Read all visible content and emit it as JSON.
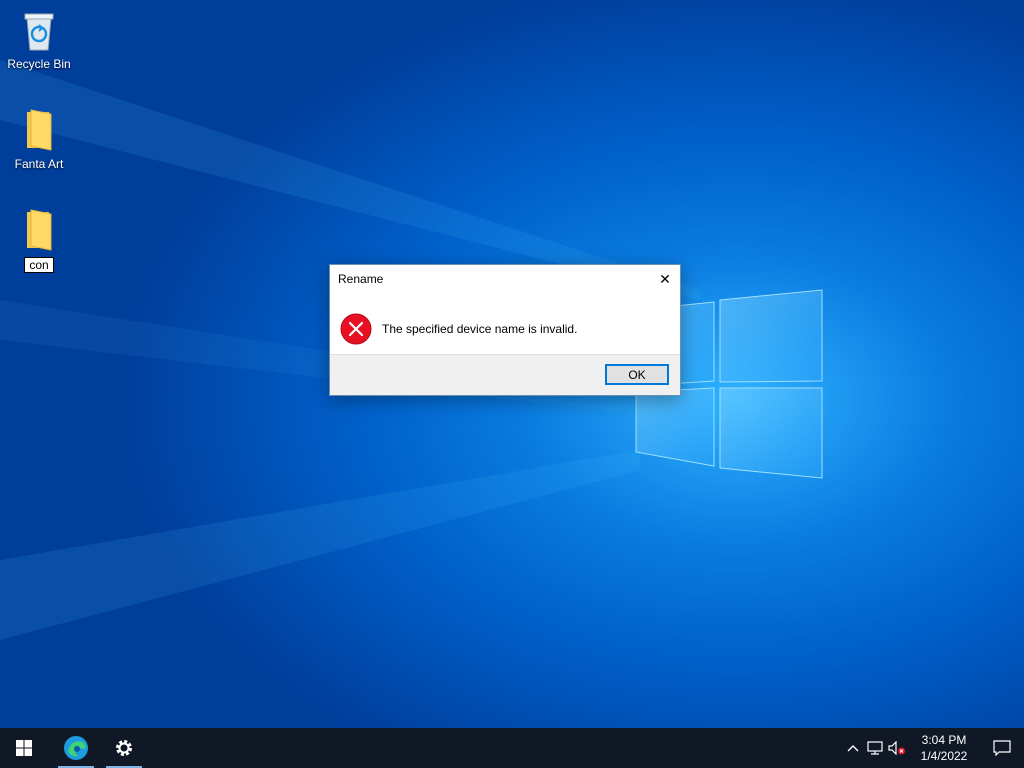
{
  "desktop": {
    "icons": [
      {
        "label": "Recycle Bin"
      },
      {
        "label": "Fanta Art"
      },
      {
        "label": "con"
      }
    ]
  },
  "dialog": {
    "title": "Rename",
    "message": "The specified device name is invalid.",
    "ok_label": "OK",
    "close_glyph": "✕"
  },
  "taskbar": {
    "pinned": [
      "start-icon",
      "edge-icon",
      "settings-icon"
    ],
    "tray": [
      "chevron-up-icon",
      "network-icon",
      "volume-muted-icon"
    ],
    "clock": {
      "time": "3:04 PM",
      "date": "1/4/2022"
    }
  },
  "colors": {
    "accent": "#0078d7",
    "error": "#e81123",
    "taskbar": "#101826"
  }
}
